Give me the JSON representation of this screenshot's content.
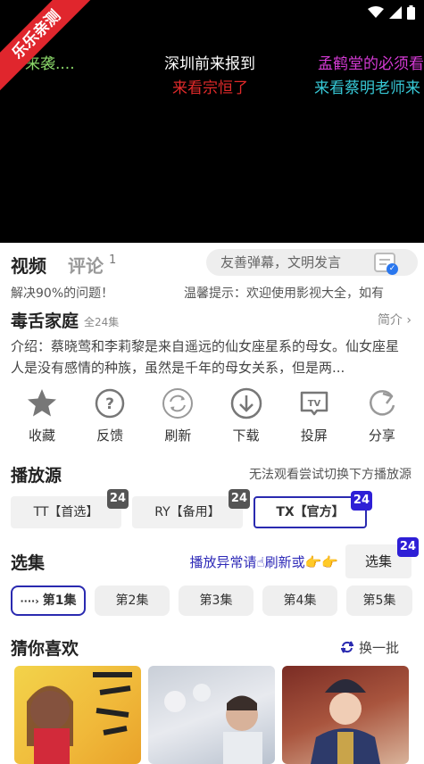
{
  "video": {
    "ribbon": "乐乐亲测",
    "danmaku": [
      {
        "text": "来袭....",
        "color": "#8bd96a"
      },
      {
        "text": "深圳前来报到",
        "color": "#ffffff"
      },
      {
        "text": "孟鹤堂的必须看",
        "color": "#d43ad4"
      },
      {
        "text": "来看宗恒了",
        "color": "#e02a2a"
      },
      {
        "text": "来看蔡明老师来",
        "color": "#37c8d6"
      }
    ]
  },
  "tabs": {
    "video": "视频",
    "comments": "评论",
    "comments_count": "1"
  },
  "danmu_input": {
    "placeholder": "友善弹幕，文明发言"
  },
  "notice": {
    "left": "解决90%的问题！",
    "right": "温馨提示：欢迎使用影视大全，如有"
  },
  "show": {
    "title": "毒舌家庭",
    "episodes_total": "全24集",
    "intro_link": "简介 ›",
    "description": "介绍：蔡晓莺和李莉黎是来自遥远的仙女座星系的母女。仙女座星人是没有感情的种族，虽然是千年的母女关系，但是两..."
  },
  "actions": [
    {
      "label": "收藏",
      "icon": "star-icon"
    },
    {
      "label": "反馈",
      "icon": "question-icon"
    },
    {
      "label": "刷新",
      "icon": "refresh-icon"
    },
    {
      "label": "下载",
      "icon": "download-icon"
    },
    {
      "label": "投屏",
      "icon": "tv-icon"
    },
    {
      "label": "分享",
      "icon": "share-icon"
    }
  ],
  "sources": {
    "title": "播放源",
    "hint": "无法观看尝试切换下方播放源",
    "items": [
      {
        "label": "TT【首选】",
        "count": "24",
        "active": false
      },
      {
        "label": "RY【备用】",
        "count": "24",
        "active": false
      },
      {
        "label": "TX【官方】",
        "count": "24",
        "active": true
      }
    ]
  },
  "episodes": {
    "title": "选集",
    "abnormal_hint": "播放异常请☝刷新或👉👉",
    "select_label": "选集",
    "select_count": "24",
    "items": [
      "第1集",
      "第2集",
      "第3集",
      "第4集",
      "第5集"
    ]
  },
  "recommend": {
    "title": "猜你喜欢",
    "refresh": "换一批"
  },
  "colors": {
    "accent": "#2a2ab0",
    "badge": "#2e1fd6",
    "ribbon": "#e0262d"
  }
}
